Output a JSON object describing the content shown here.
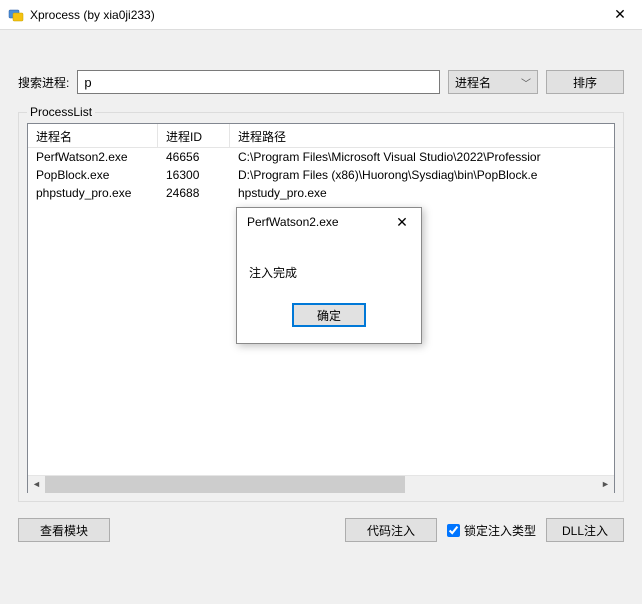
{
  "window": {
    "title": "Xprocess (by xia0ji233)"
  },
  "search": {
    "label": "搜索进程:",
    "value": "p",
    "combo_selected": "进程名",
    "sort_button": "排序"
  },
  "groupbox": {
    "title": "ProcessList"
  },
  "table": {
    "columns": {
      "name": "进程名",
      "pid": "进程ID",
      "path": "进程路径"
    },
    "rows": [
      {
        "name": "PerfWatson2.exe",
        "pid": "46656",
        "path": "C:\\Program Files\\Microsoft Visual Studio\\2022\\Professior"
      },
      {
        "name": "PopBlock.exe",
        "pid": "16300",
        "path": "D:\\Program Files (x86)\\Huorong\\Sysdiag\\bin\\PopBlock.e"
      },
      {
        "name": "phpstudy_pro.exe",
        "pid": "24688",
        "path": "hpstudy_pro.exe"
      }
    ]
  },
  "bottom": {
    "view_module": "查看模块",
    "code_inject": "代码注入",
    "lock_inject_type": "锁定注入类型",
    "dll_inject": "DLL注入"
  },
  "dialog": {
    "title": "PerfWatson2.exe",
    "message": "注入完成",
    "ok": "确定"
  }
}
